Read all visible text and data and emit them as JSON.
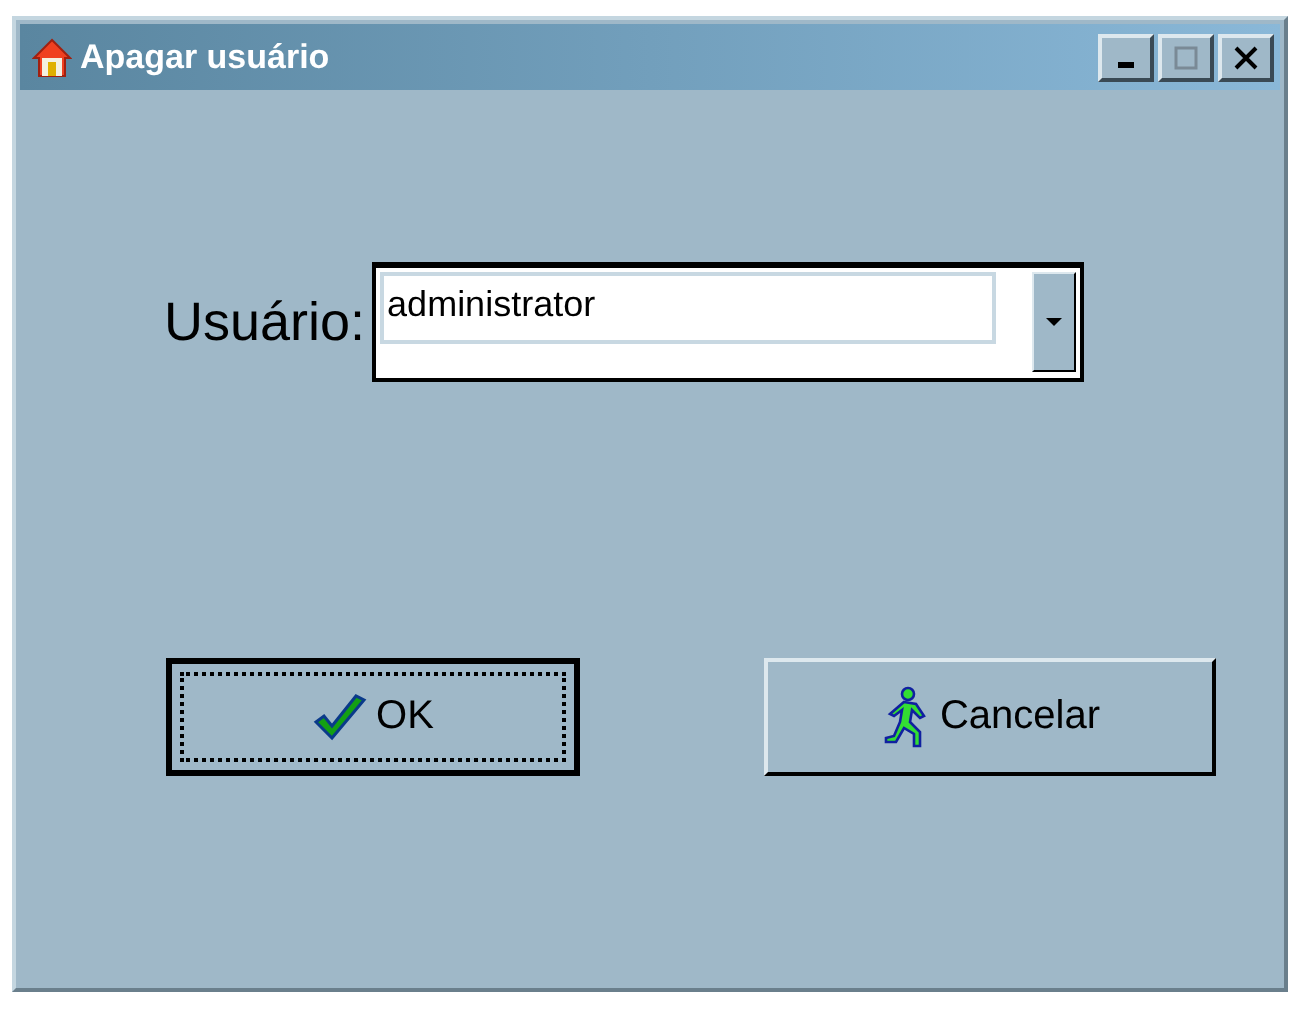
{
  "window": {
    "title": "Apagar usuário"
  },
  "user_field": {
    "label": "Usuário:",
    "value": "administrator"
  },
  "buttons": [
    {
      "kind": "ok",
      "label": "OK",
      "focused": true
    },
    {
      "kind": "cancel",
      "label": "Cancelar",
      "focused": false
    }
  ]
}
